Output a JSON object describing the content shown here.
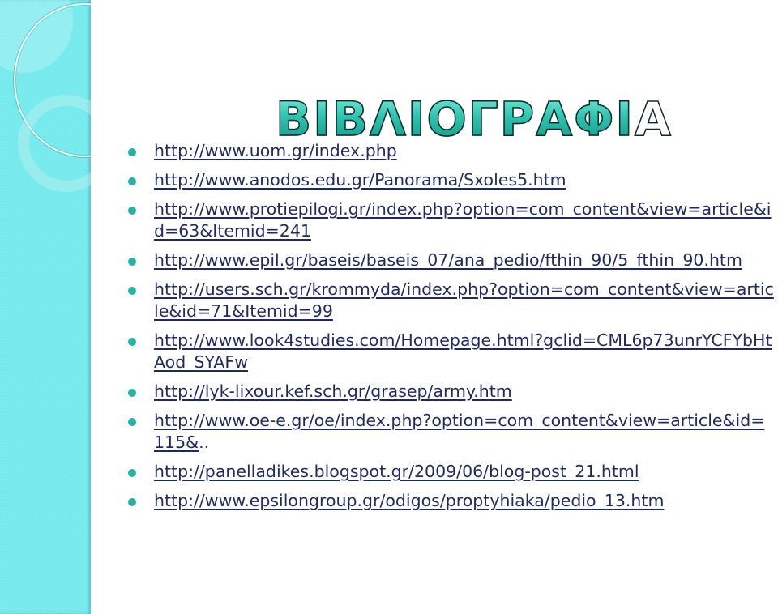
{
  "slide": {
    "title": "ΒΙΒΛΙΟΓΡΑΦΙΑ",
    "colors": {
      "side_panel": "#72e9ec",
      "bullet": "#27b3a3",
      "link_text": "#1f2b5e",
      "title_fill": "#2fc4b0"
    },
    "references": [
      {
        "link": "http://www.uom.gr/index.php",
        "tail": ""
      },
      {
        "link": "http://www.anodos.edu.gr/Panorama/Sxoles5.htm",
        "tail": ""
      },
      {
        "link": "http://www.protiepilogi.gr/index.php?option=com_content&view=article&id=63&Itemid=241",
        "tail": ""
      },
      {
        "link": "http://www.epil.gr/baseis/baseis_07/ana_pedio/fthin_90/5_fthin_90.htm",
        "tail": ""
      },
      {
        "link": "http://users.sch.gr/krommyda/index.php?option=com_content&view=article&id=71&Itemid=99",
        "tail": ""
      },
      {
        "link": "http://www.look4studies.com/Homepage.html?gclid=CML6p73unrYCFYbHtAod_SYAFw",
        "tail": ""
      },
      {
        "link": "http://lyk-lixour.kef.sch.gr/grasep/army.htm",
        "tail": ""
      },
      {
        "link": "http://www.oe-e.gr/oe/index.php?option=com_content&view=article&id=115&",
        "tail": ".."
      },
      {
        "link": "http://panelladikes.blogspot.gr/2009/06/blog-post_21.html",
        "tail": ""
      },
      {
        "link": "http://www.epsilongroup.gr/odigos/proptyhiaka/pedio_13.htm",
        "tail": ""
      }
    ]
  }
}
